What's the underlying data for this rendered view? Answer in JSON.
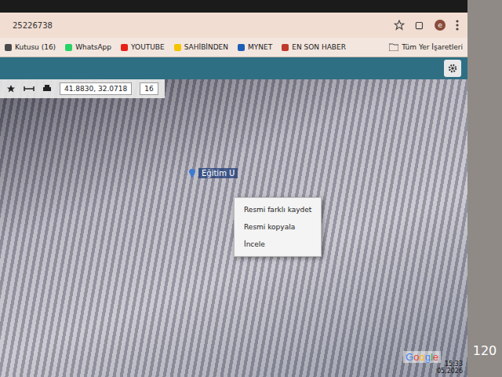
{
  "browser": {
    "url": "25226738",
    "profile": "e",
    "all_bookmarks": "Tüm Yer İşaretleri"
  },
  "bookmarks": [
    {
      "label": "Kutusu (16)",
      "color": "#4a4a4a"
    },
    {
      "label": "WhatsApp",
      "color": "#25d366"
    },
    {
      "label": "YOUTUBE",
      "color": "#e62117"
    },
    {
      "label": "SAHİBİNDEN",
      "color": "#f5c400"
    },
    {
      "label": "MYNET",
      "color": "#1a5fb4"
    },
    {
      "label": "EN SON HABER",
      "color": "#c0392b"
    }
  ],
  "map_toolbar": {
    "coordinates": "41.8830, 32.0718",
    "zoom": "16"
  },
  "map": {
    "marker_label": "Eğitim U"
  },
  "context_menu": [
    "Resmi farklı kaydet",
    "Resmi kopyala",
    "İncele"
  ],
  "attribution": "Google",
  "clock": {
    "time": "15:33",
    "date": "05.2026"
  },
  "wall_label": "120"
}
